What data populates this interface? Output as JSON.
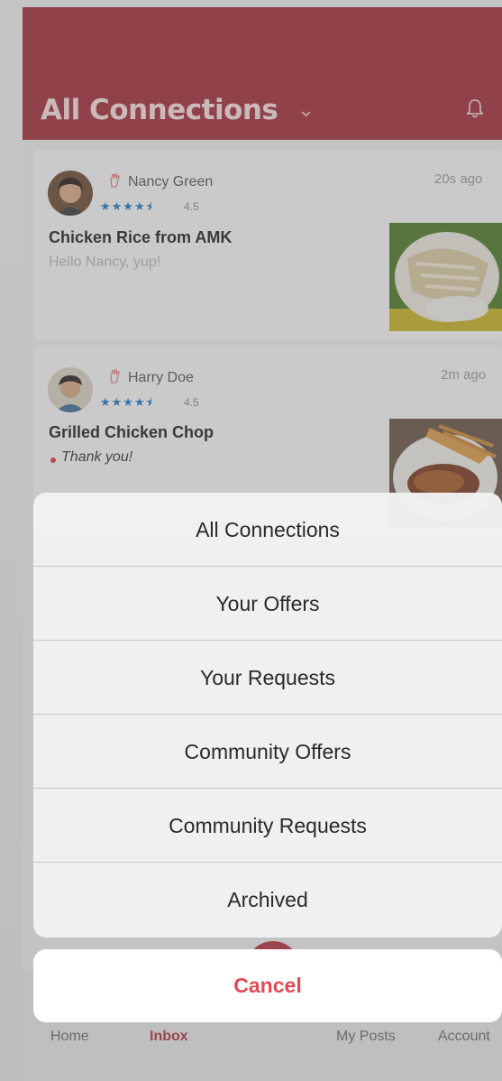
{
  "header": {
    "title": "All Connections",
    "accent_color": "#a32d38",
    "chevron_icon": "chevron-down-icon",
    "bell_icon": "bell-icon"
  },
  "conversations": [
    {
      "name": "Nancy Green",
      "rating": "4.5",
      "stars": "★★★★⯨",
      "time": "20s ago",
      "title": "Chicken Rice from AMK",
      "message": "Hello Nancy, yup!",
      "unread": false
    },
    {
      "name": "Harry Doe",
      "rating": "4.5",
      "stars": "★★★★⯨",
      "time": "2m ago",
      "title": "Grilled Chicken Chop",
      "message": "Thank you!",
      "unread": true
    }
  ],
  "action_sheet": {
    "options": [
      "All Connections",
      "Your Offers",
      "Your Requests",
      "Community Offers",
      "Community Requests",
      "Archived"
    ],
    "cancel_label": "Cancel",
    "cancel_color": "#e24a56"
  },
  "tabbar": {
    "items": [
      "Home",
      "Inbox",
      "My Posts",
      "Account"
    ],
    "active": "Inbox"
  }
}
